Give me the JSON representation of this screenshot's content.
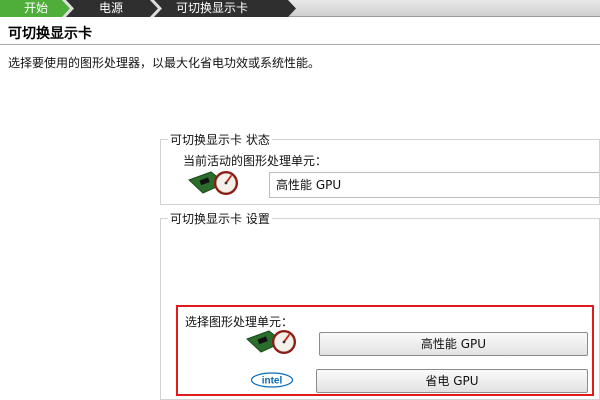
{
  "breadcrumb": [
    "开始",
    "电源",
    "可切换显示卡"
  ],
  "page": {
    "title": "可切换显示卡",
    "description": "选择要使用的图形处理器，以最大化省电功效或系统性能。"
  },
  "status_group": {
    "legend": "可切换显示卡 状态",
    "current_label": "当前活动的图形处理单元：",
    "current_value": "高性能 GPU",
    "icon": "amd-gpu-gauge-icon"
  },
  "settings_group": {
    "legend": "可切换显示卡 设置",
    "select_label": "选择图形处理单元：",
    "high_perf_button": "高性能 GPU",
    "power_saving_button": "省电 GPU",
    "high_perf_icon": "amd-gpu-gauge-icon",
    "power_saving_icon": "intel-logo",
    "intel_text": "intel"
  },
  "colors": {
    "highlight": "#e11b1b",
    "breadcrumb_dark": "#2f2f2f",
    "breadcrumb_active": "#4fae3a"
  }
}
